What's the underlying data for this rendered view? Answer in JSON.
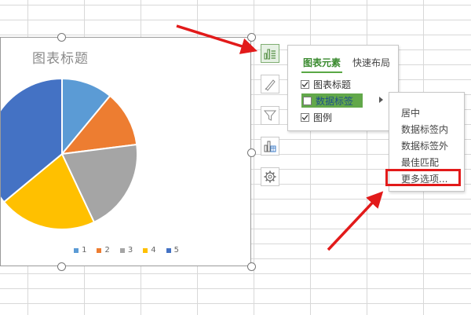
{
  "chart": {
    "title": "图表标题"
  },
  "chart_data": {
    "type": "pie",
    "title": "图表标题",
    "categories": [
      "1",
      "2",
      "3",
      "4",
      "5"
    ],
    "values": [
      11,
      12,
      20,
      21,
      36
    ],
    "colors": [
      "#5b9bd5",
      "#ed7d31",
      "#a5a5a5",
      "#ffc000",
      "#4472c4"
    ],
    "legend_position": "bottom"
  },
  "tools": {
    "items": [
      {
        "name": "chart-elements",
        "icon": "chart-elements-icon"
      },
      {
        "name": "chart-styles",
        "icon": "brush-icon"
      },
      {
        "name": "chart-filter",
        "icon": "filter-icon"
      },
      {
        "name": "chart-layout",
        "icon": "chart-layout-icon"
      },
      {
        "name": "chart-settings",
        "icon": "gear-icon"
      }
    ],
    "active_color": "#5aa845"
  },
  "elements_panel": {
    "tabs": [
      "图表元素",
      "快速布局"
    ],
    "items": [
      {
        "label": "图表标题",
        "checked": true
      },
      {
        "label": "数据标签",
        "checked": false,
        "highlighted": true
      },
      {
        "label": "图例",
        "checked": true
      }
    ]
  },
  "label_submenu": {
    "items": [
      "居中",
      "数据标签内",
      "数据标签外",
      "最佳匹配",
      "更多选项..."
    ]
  },
  "annotation_color": "#e21a1a"
}
